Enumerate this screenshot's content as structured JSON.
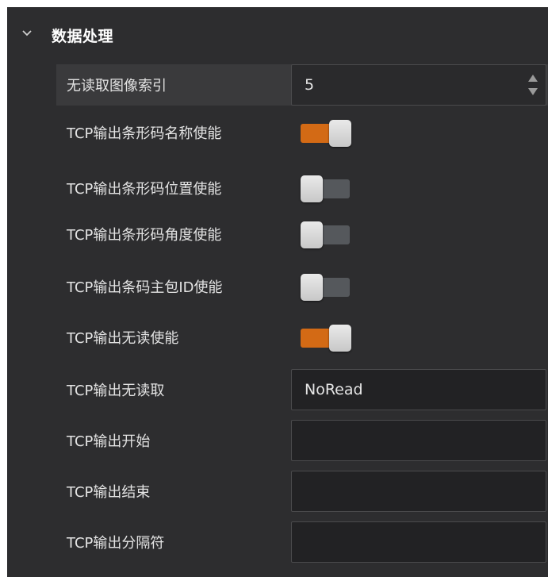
{
  "section": {
    "title": "数据处理",
    "icon": "chevron-down-icon"
  },
  "rows": {
    "no_read_image_index": {
      "label": "无读取图像索引",
      "value": "5"
    },
    "barcode_name_enable": {
      "label": "TCP输出条形码名称使能",
      "on": true
    },
    "barcode_position_enable": {
      "label": "TCP输出条形码位置使能",
      "on": false
    },
    "barcode_angle_enable": {
      "label": "TCP输出条形码角度使能",
      "on": false
    },
    "barcode_packet_id_enable": {
      "label": "TCP输出条码主包ID使能",
      "on": false
    },
    "no_read_enable": {
      "label": "TCP输出无读使能",
      "on": true
    },
    "no_read_text": {
      "label": "TCP输出无读取",
      "value": "NoRead"
    },
    "output_start": {
      "label": "TCP输出开始",
      "value": ""
    },
    "output_end": {
      "label": "TCP输出结束",
      "value": ""
    },
    "output_separator": {
      "label": "TCP输出分隔符",
      "value": ""
    }
  },
  "colors": {
    "toggle_on": "#d36a15",
    "toggle_off": "#55585c",
    "panel_bg": "#2d2d2f"
  }
}
